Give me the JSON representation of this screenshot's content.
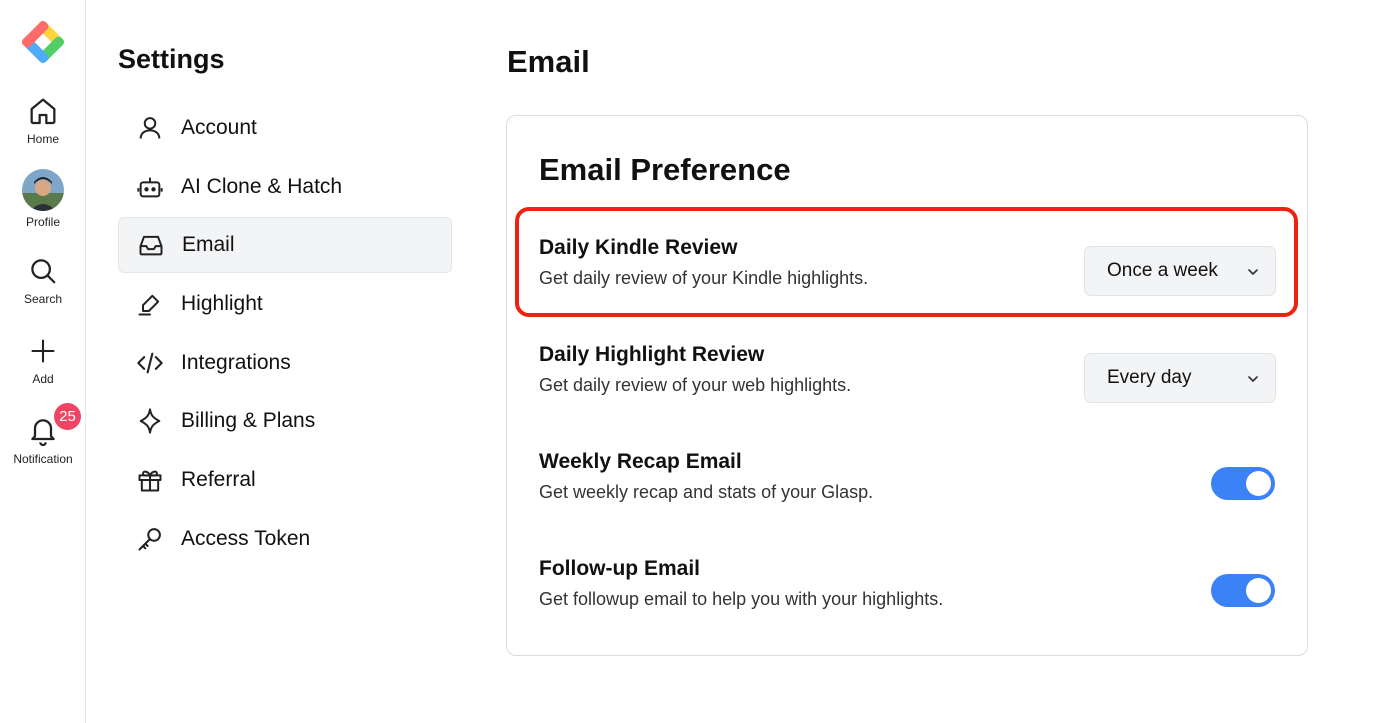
{
  "colors": {
    "accent": "#3b82f6",
    "badge": "#ef4565",
    "highlight_outline": "#ee2211",
    "active_nav_bg": "#f3f4f6"
  },
  "rail": {
    "items": [
      {
        "label": "Home",
        "icon": "home-icon"
      },
      {
        "label": "Profile",
        "icon": "avatar"
      },
      {
        "label": "Search",
        "icon": "search-icon"
      },
      {
        "label": "Add",
        "icon": "plus-icon"
      },
      {
        "label": "Notification",
        "icon": "bell-icon"
      }
    ],
    "notification_count": "25"
  },
  "settings": {
    "title": "Settings",
    "nav": [
      {
        "label": "Account",
        "icon": "user-icon",
        "active": false
      },
      {
        "label": "AI Clone & Hatch",
        "icon": "robot-icon",
        "active": false
      },
      {
        "label": "Email",
        "icon": "inbox-icon",
        "active": true
      },
      {
        "label": "Highlight",
        "icon": "highlighter-icon",
        "active": false
      },
      {
        "label": "Integrations",
        "icon": "code-icon",
        "active": false
      },
      {
        "label": "Billing & Plans",
        "icon": "sparkle-icon",
        "active": false
      },
      {
        "label": "Referral",
        "icon": "gift-icon",
        "active": false
      },
      {
        "label": "Access Token",
        "icon": "key-icon",
        "active": false
      }
    ]
  },
  "main": {
    "page_title": "Email",
    "card_title": "Email Preference",
    "preferences": [
      {
        "title": "Daily Kindle Review",
        "description": "Get daily review of your Kindle highlights.",
        "control": "select",
        "value": "Once a week"
      },
      {
        "title": "Daily Highlight Review",
        "description": "Get daily review of your web highlights.",
        "control": "select",
        "value": "Every day"
      },
      {
        "title": "Weekly Recap Email",
        "description": "Get weekly recap and stats of your Glasp.",
        "control": "toggle",
        "on": true
      },
      {
        "title": "Follow-up Email",
        "description": "Get followup email to help you with your highlights.",
        "control": "toggle",
        "on": true
      }
    ]
  }
}
